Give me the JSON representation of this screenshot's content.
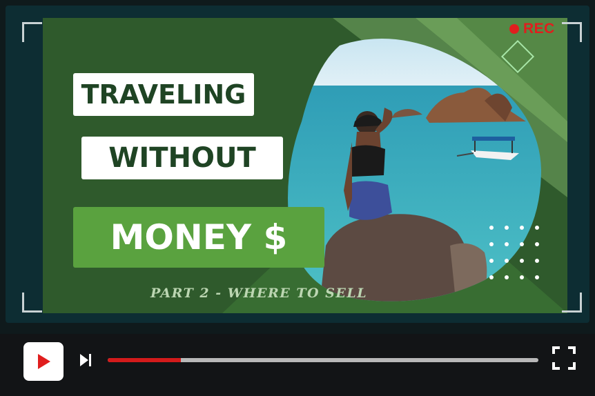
{
  "video": {
    "title_line1": "TRAVELING",
    "title_line2": "WITHOUT",
    "title_line3": "MONEY $",
    "subtitle": "PART 2 - WHERE TO SELL",
    "rec_label": "REC"
  },
  "player": {
    "progress_fraction": 0.17,
    "play_icon": "youtube-play-icon",
    "next_icon": "skip-next-icon",
    "fullscreen_icon": "fullscreen-icon"
  },
  "colors": {
    "accent_red": "#d31b1b",
    "title_green": "#5aa23f",
    "dark_green": "#2f5a2c"
  }
}
